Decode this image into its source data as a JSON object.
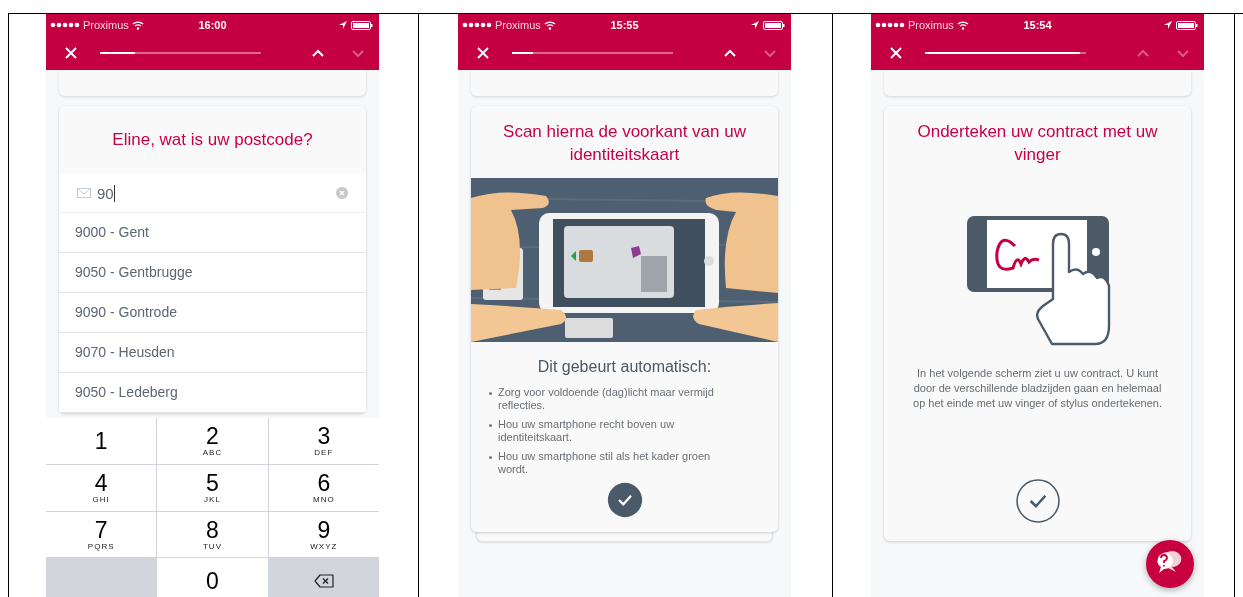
{
  "panels": [
    {
      "kind": "postcode",
      "status_bar": {
        "carrier": "Proximus",
        "time": "16:00"
      },
      "nav": {
        "progress": {
          "level": 0.22
        },
        "up_enabled": true,
        "down_enabled": false
      },
      "card": {
        "title": "Eline, wat is uw postcode?",
        "input": {
          "value": "90"
        },
        "suggestions": [
          "9000 - Gent",
          "9050 - Gentbrugge",
          "9090 - Gontrode",
          "9070 - Heusden",
          "9050 - Ledeberg"
        ]
      },
      "keyboard": [
        {
          "kind": "digit",
          "digit": "1"
        },
        {
          "kind": "digit",
          "digit": "2",
          "letters": "ABC"
        },
        {
          "kind": "digit",
          "digit": "3",
          "letters": "DEF"
        },
        {
          "kind": "digit",
          "digit": "4",
          "letters": "GHI"
        },
        {
          "kind": "digit",
          "digit": "5",
          "letters": "JKL"
        },
        {
          "kind": "digit",
          "digit": "6",
          "letters": "MNO"
        },
        {
          "kind": "digit",
          "digit": "7",
          "letters": "PQRS"
        },
        {
          "kind": "digit",
          "digit": "8",
          "letters": "TUV"
        },
        {
          "kind": "digit",
          "digit": "9",
          "letters": "WXYZ"
        },
        {
          "kind": "blank"
        },
        {
          "kind": "digit",
          "digit": "0"
        },
        {
          "kind": "delete"
        }
      ]
    },
    {
      "kind": "scan",
      "status_bar": {
        "carrier": "Proximus",
        "time": "15:55"
      },
      "nav": {
        "progress": {
          "level": 0.13
        },
        "up_enabled": true,
        "down_enabled": false
      },
      "card": {
        "title": "Scan hierna de voorkant van uw identiteitskaart",
        "heading": "Dit gebeurt automatisch:",
        "bullets": [
          "Zorg voor voldoende (dag)licht maar vermijd reflecties.",
          "Hou uw smartphone recht boven uw identiteitskaart.",
          "Hou uw smartphone stil als het kader groen wordt."
        ],
        "confirm": {
          "filled": true
        },
        "stacked": true
      }
    },
    {
      "kind": "sign",
      "status_bar": {
        "carrier": "Proximus",
        "time": "15:54"
      },
      "nav": {
        "progress": {
          "level": 0.96
        },
        "up_enabled": false,
        "down_enabled": false
      },
      "card": {
        "title": "Onderteken uw contract met uw vinger",
        "text": "In het volgende scherm ziet u uw contract. U kunt door de verschillende bladzijden gaan en helemaal op het einde met uw vinger of stylus ondertekenen.",
        "confirm": {
          "filled": false
        }
      },
      "help_button": true
    }
  ]
}
